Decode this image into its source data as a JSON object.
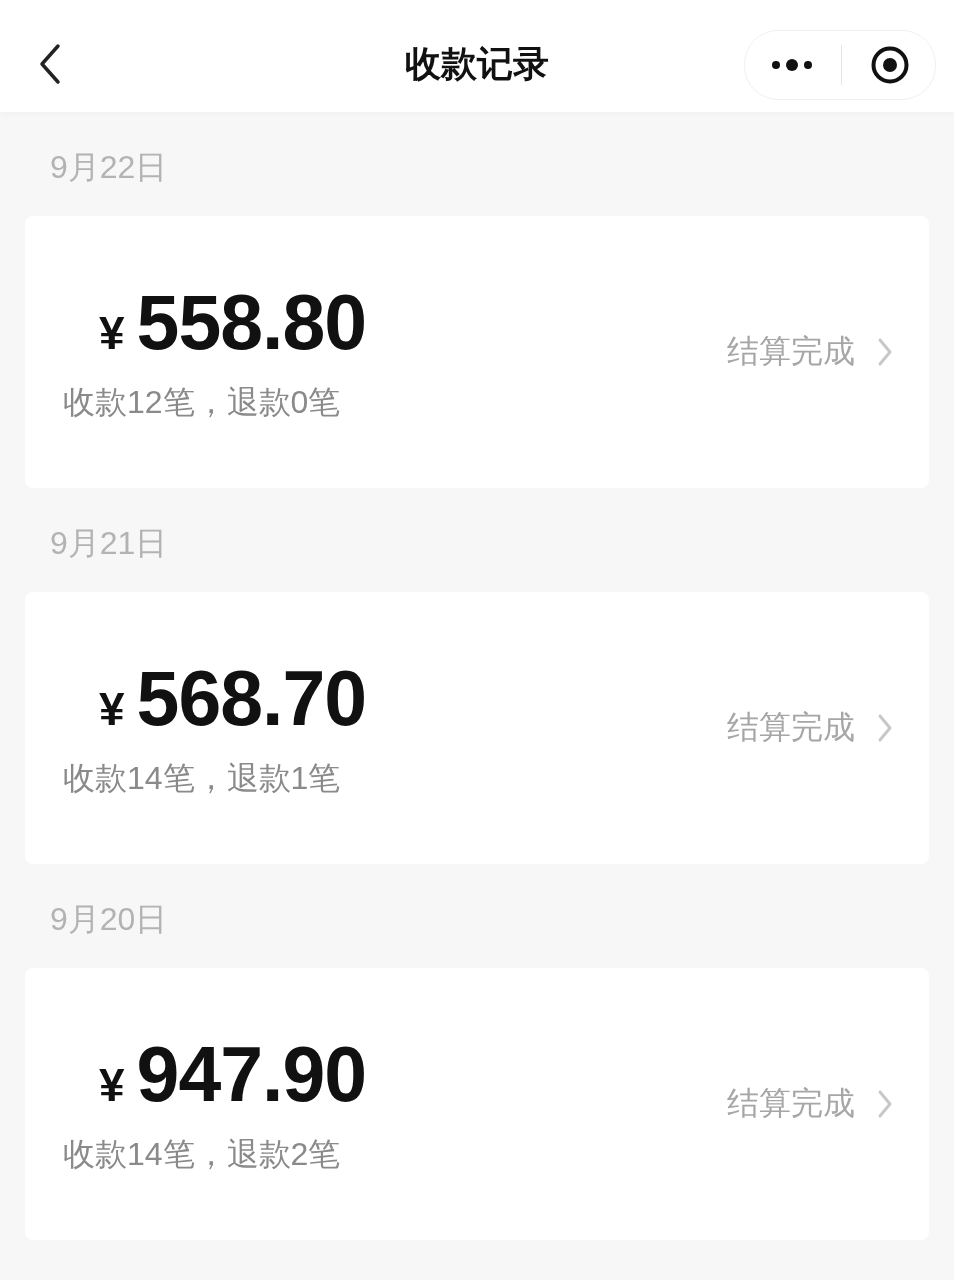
{
  "nav": {
    "title": "收款记录"
  },
  "days": [
    {
      "date": "9月22日",
      "currency": "¥",
      "amount": "558.80",
      "summary": "收款12笔，退款0笔",
      "status": "结算完成"
    },
    {
      "date": "9月21日",
      "currency": "¥",
      "amount": "568.70",
      "summary": "收款14笔，退款1笔",
      "status": "结算完成"
    },
    {
      "date": "9月20日",
      "currency": "¥",
      "amount": "947.90",
      "summary": "收款14笔，退款2笔",
      "status": "结算完成"
    }
  ]
}
